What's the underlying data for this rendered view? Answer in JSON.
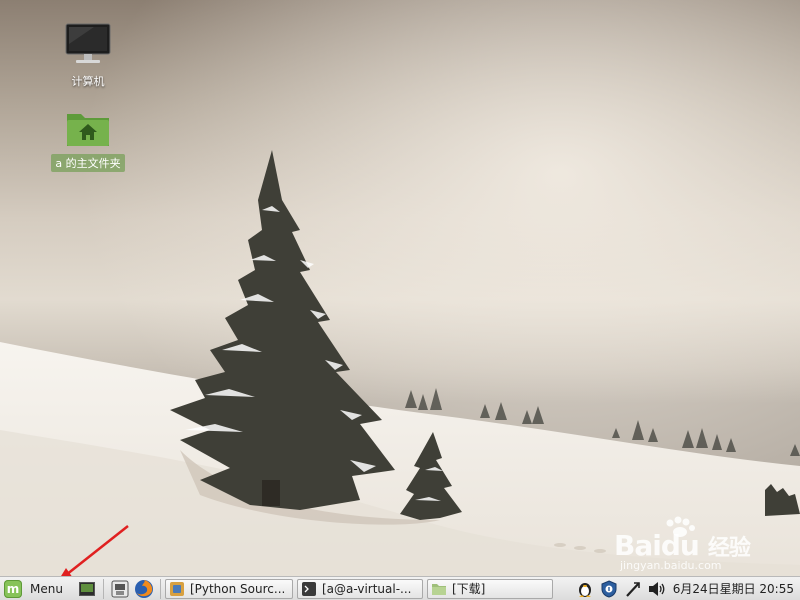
{
  "desktop": {
    "icons": [
      {
        "label": "计算机",
        "icon": "monitor-icon"
      },
      {
        "label": "a 的主文件夹",
        "icon": "home-folder-icon",
        "selected": true
      }
    ]
  },
  "taskbar": {
    "menu_label": "Menu",
    "launchers": [
      "show-desktop-icon",
      "file-manager-icon",
      "firefox-icon"
    ],
    "windows": [
      {
        "label": "[Python Sourc...",
        "icon": "python-icon"
      },
      {
        "label": "[a@a-virtual-...",
        "icon": "terminal-icon"
      },
      {
        "label": "[下载]",
        "icon": "folder-icon"
      }
    ],
    "tray": [
      "penguin-icon",
      "shield-update-icon",
      "network-icon",
      "volume-icon"
    ],
    "clock": "6月24日星期日 20:55"
  },
  "watermark": {
    "brand": "Baidu",
    "cn": "经验",
    "url": "jingyan.baidu.com"
  },
  "colors": {
    "taskbar_bg": "#e8e8e8",
    "mint_green": "#87c35a",
    "annotation_arrow": "#e02020"
  }
}
